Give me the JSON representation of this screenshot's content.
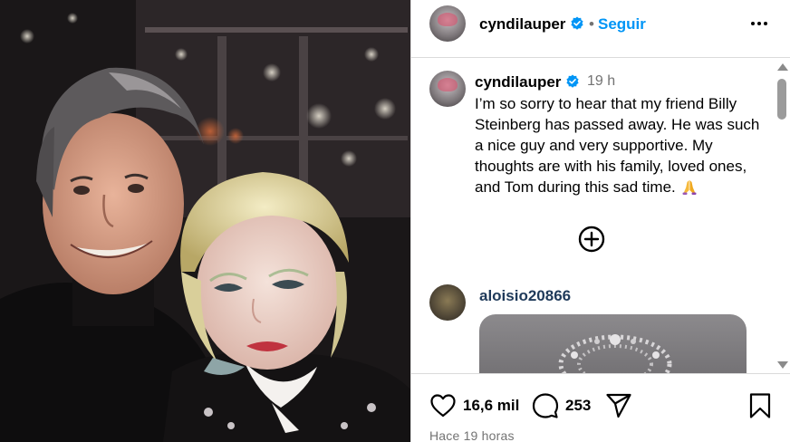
{
  "post": {
    "username": "cyndilauper",
    "separator": "•",
    "follow_label": "Seguir",
    "verified_icon": "verified-badge-icon",
    "more_icon": "more-options-icon"
  },
  "caption": {
    "username": "cyndilauper",
    "time": "19 h",
    "text": "I’m so sorry to hear that my friend Billy Steinberg has passed away. He was such a nice guy and very supportive. My thoughts are with his family, loved ones, and Tom during this sad time.",
    "emoji": "praying-hands-emoji"
  },
  "load_more_icon": "plus-circle-icon",
  "comment": {
    "username": "aloisio20866"
  },
  "actions": {
    "like_count": "16,6 mil",
    "comment_count": "253",
    "timestamp": "Hace 19 horas"
  },
  "colors": {
    "link_blue": "#0095f6",
    "verified_blue": "#0095f6",
    "muted_text": "#737373",
    "border": "#dbdbdb"
  }
}
